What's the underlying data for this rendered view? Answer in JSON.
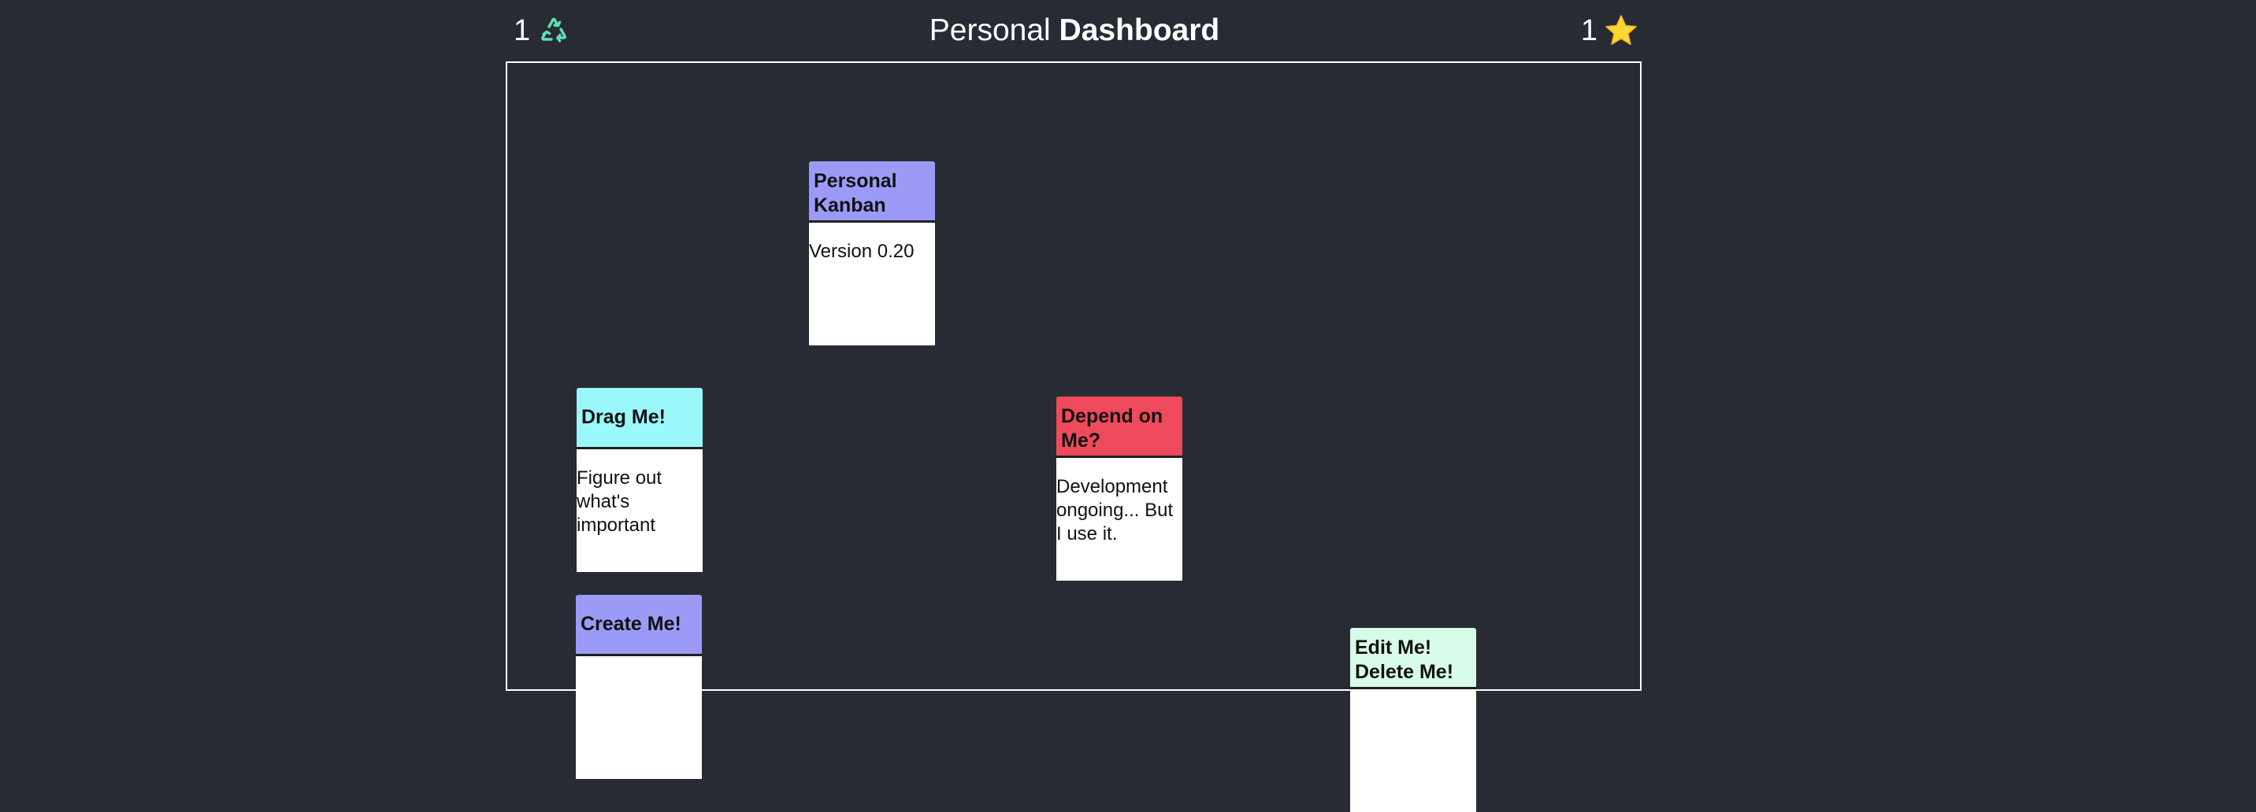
{
  "header": {
    "recycle_count": "1",
    "recycle_icon": "recycle-icon",
    "title_light": "Personal",
    "title_bold": "Dashboard",
    "star_count": "1",
    "star_icon": "star-icon"
  },
  "colors": {
    "background": "#282b33",
    "card_periwinkle": "#9b9bf7",
    "card_cyan": "#9af7fa",
    "card_red": "#ef4a5c",
    "card_mint": "#d8fbea",
    "recycle": "#5fe0b3",
    "star": "#fdd835"
  },
  "cards": [
    {
      "title": "Personal Kanban",
      "body": "Version 0.20"
    },
    {
      "title": "Drag Me!",
      "body": "Figure out what's important"
    },
    {
      "title": "Depend on Me?",
      "body": "Development ongoing... But I use it."
    },
    {
      "title": "Create Me!",
      "body": ""
    },
    {
      "title": "Edit Me! Delete Me!",
      "body": ""
    }
  ]
}
